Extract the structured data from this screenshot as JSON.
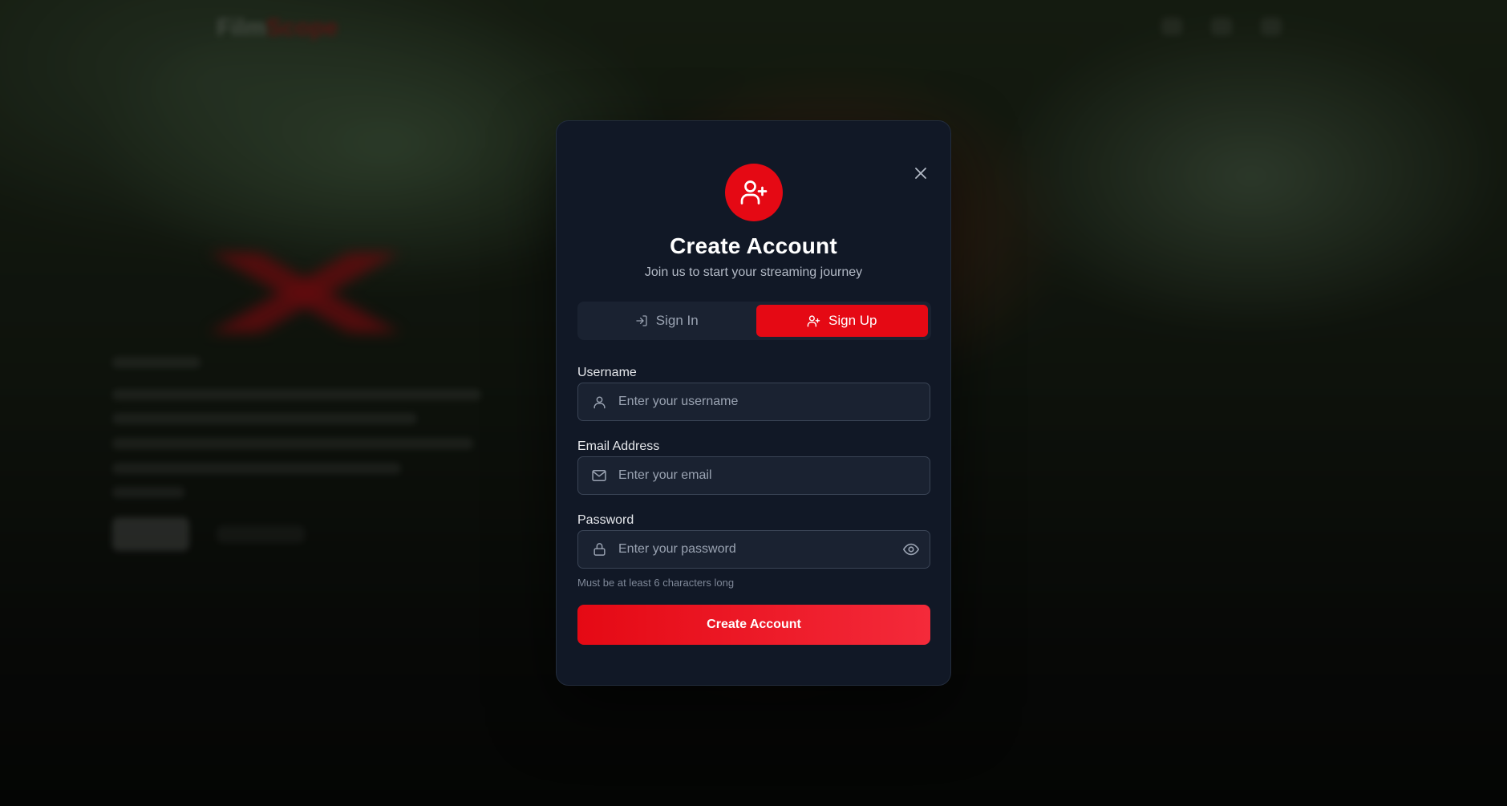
{
  "background": {
    "logo_part1": "Film",
    "logo_part2": "Scope"
  },
  "modal": {
    "avatar_icon": "user-plus-icon",
    "close_icon": "close-icon",
    "title": "Create Account",
    "subtitle": "Join us to start your streaming journey",
    "tabs": [
      {
        "label": "Sign In",
        "icon": "log-in-icon",
        "active": false
      },
      {
        "label": "Sign Up",
        "icon": "user-plus-icon",
        "active": true
      }
    ],
    "fields": {
      "username": {
        "label": "Username",
        "placeholder": "Enter your username",
        "value": "",
        "icon": "user-icon"
      },
      "email": {
        "label": "Email Address",
        "placeholder": "Enter your email",
        "value": "",
        "icon": "mail-icon"
      },
      "password": {
        "label": "Password",
        "placeholder": "Enter your password",
        "value": "",
        "icon": "lock-icon",
        "toggle_icon": "eye-icon"
      }
    },
    "password_hint": "Must be at least 6 characters long",
    "submit_label": "Create Account"
  },
  "colors": {
    "accent": "#e50914",
    "modal_bg": "#111826",
    "field_bg": "#1a2231",
    "field_border": "#3a4455"
  }
}
